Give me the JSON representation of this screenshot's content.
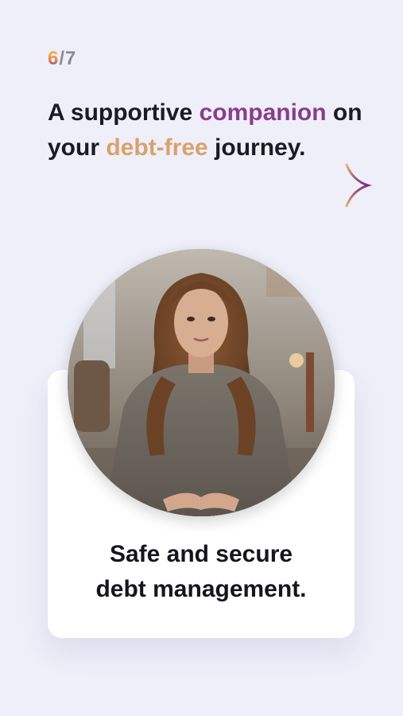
{
  "progress": {
    "current": "6",
    "separator": "/",
    "total": "7"
  },
  "headline": {
    "part1": "A supportive ",
    "highlight1": "companion",
    "part2": " on your ",
    "highlight2": "debt-free",
    "part3": " journey."
  },
  "card": {
    "caption_line1": "Safe and secure",
    "caption_line2": "debt management."
  },
  "colors": {
    "background": "#efeffa",
    "accent_purple": "#8a3d8c",
    "accent_gold": "#d9a26a",
    "text": "#1b1b24"
  },
  "icons": {
    "arrow": "arrow-right-icon"
  }
}
